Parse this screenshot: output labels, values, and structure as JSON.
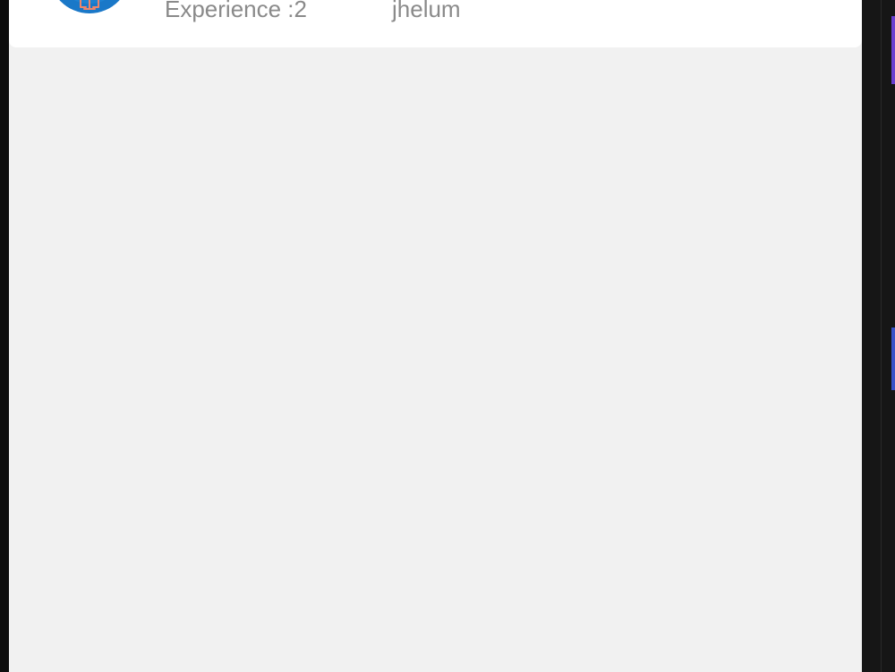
{
  "lawyer_card": {
    "experience_text": "Experience :2",
    "location_text": "jhelum",
    "avatar_icon": "scales-of-justice-icon"
  },
  "colors": {
    "screen_background": "#f1f1f1",
    "card_background": "#ffffff",
    "secondary_text": "#8a8a8a",
    "avatar_blue": "#1a78c8",
    "avatar_accent": "#f0856a"
  }
}
